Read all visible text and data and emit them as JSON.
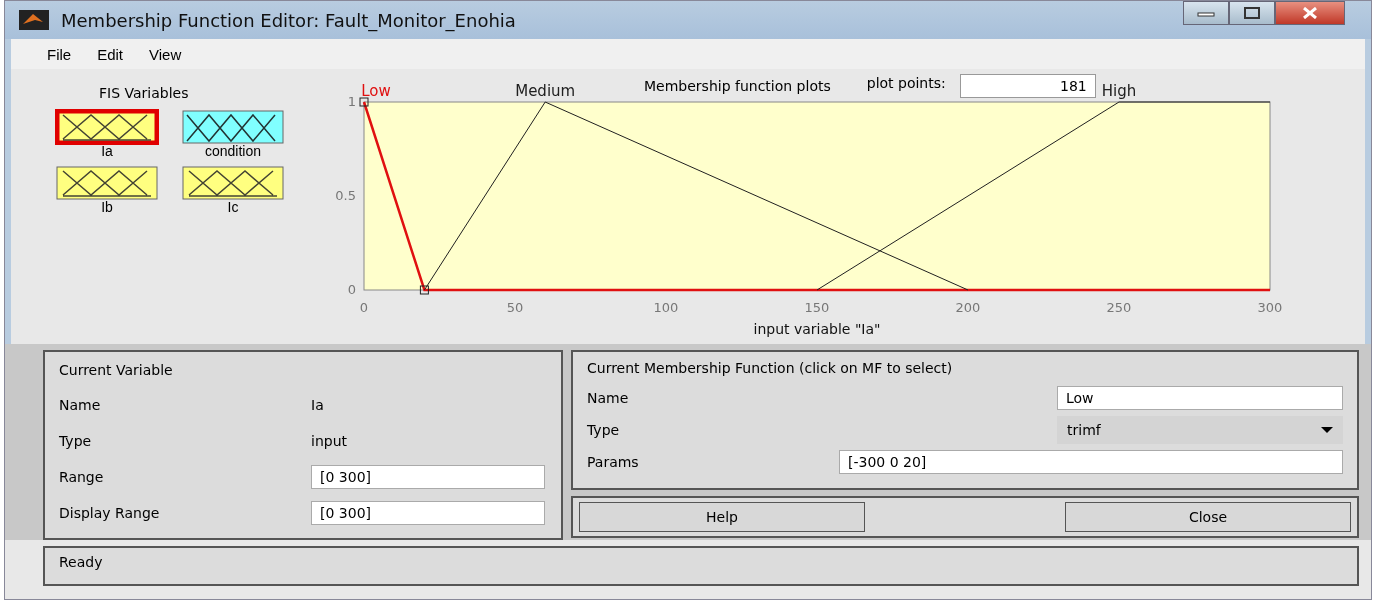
{
  "window": {
    "title": "Membership Function Editor: Fault_Monitor_Enohia"
  },
  "menu": [
    "File",
    "Edit",
    "View"
  ],
  "fis_variables": {
    "title": "FIS Variables",
    "items": [
      {
        "name": "Ia",
        "kind": "input",
        "selected": true
      },
      {
        "name": "condition",
        "kind": "output",
        "selected": false
      },
      {
        "name": "Ib",
        "kind": "input",
        "selected": false
      },
      {
        "name": "Ic",
        "kind": "input",
        "selected": false
      }
    ]
  },
  "plot": {
    "title": "Membership function plots",
    "plot_points_label": "plot points:",
    "plot_points": "181",
    "chart_data": {
      "type": "line",
      "xlabel": "input variable \"Ia\"",
      "x": [
        0,
        20,
        60,
        150,
        200,
        250,
        300
      ],
      "xlim": [
        0,
        300
      ],
      "ylim": [
        0,
        1
      ],
      "xticks": [
        0,
        50,
        100,
        150,
        200,
        250,
        300
      ],
      "yticks": [
        0,
        0.5,
        1
      ],
      "series": [
        {
          "name": "Low",
          "color": "#e01010",
          "values": [
            1,
            0,
            0,
            0,
            0,
            0,
            0
          ]
        },
        {
          "name": "Medium",
          "color": "#202020",
          "values": [
            null,
            0,
            1,
            0.357,
            0,
            null,
            null
          ]
        },
        {
          "name": "High",
          "color": "#202020",
          "values": [
            null,
            null,
            null,
            0,
            0.5,
            1,
            1
          ]
        }
      ]
    },
    "curve_selected": [
      true,
      false,
      false
    ]
  },
  "current_variable": {
    "title": "Current Variable",
    "fields": [
      {
        "label": "Name",
        "value": "Ia",
        "kind": "text"
      },
      {
        "label": "Type",
        "value": "input",
        "kind": "text"
      },
      {
        "label": "Range",
        "value": "[0 300]",
        "kind": "field"
      },
      {
        "label": "Display Range",
        "value": "[0 300]",
        "kind": "field"
      }
    ]
  },
  "current_mf": {
    "title": "Current Membership Function (click on MF to select)",
    "fields": [
      {
        "label": "Name",
        "value": "Low",
        "kind": "field"
      },
      {
        "label": "Type",
        "value": "trimf",
        "kind": "dropdown"
      },
      {
        "label": "Params",
        "value": "[-300 0 20]",
        "kind": "wide"
      }
    ]
  },
  "buttons": [
    "Help",
    "Close"
  ],
  "status_bar": "Ready"
}
